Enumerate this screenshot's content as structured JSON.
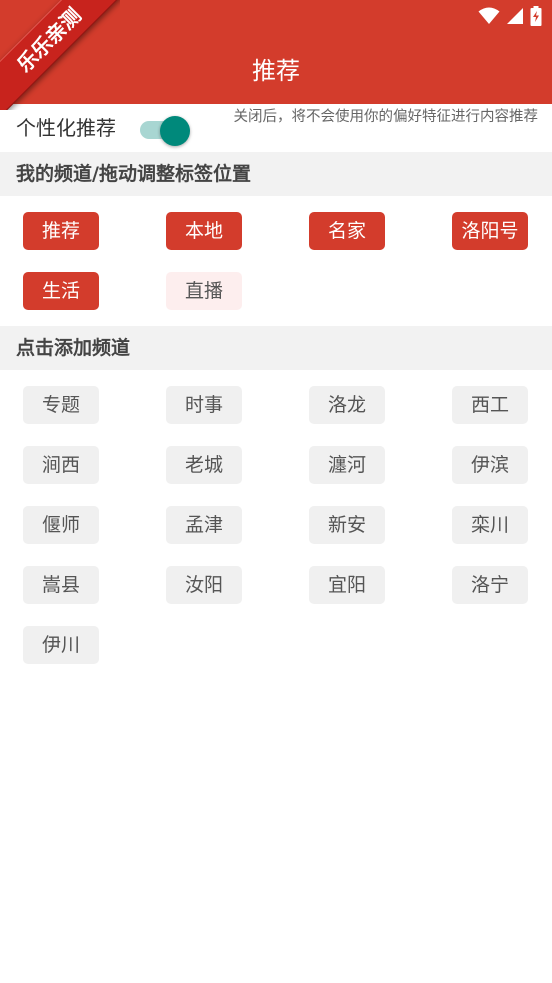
{
  "ribbon": {
    "text": "乐乐亲测"
  },
  "header": {
    "title": "推荐"
  },
  "personalization": {
    "label": "个性化推荐",
    "enabled": true,
    "description": "关闭后，将不会使用你的偏好特征进行内容推荐"
  },
  "my_channels": {
    "title": "我的频道/拖动调整标签位置",
    "items": [
      {
        "label": "推荐",
        "state": "active"
      },
      {
        "label": "本地",
        "state": "active"
      },
      {
        "label": "名家",
        "state": "active"
      },
      {
        "label": "洛阳号",
        "state": "active"
      },
      {
        "label": "生活",
        "state": "active"
      },
      {
        "label": "直播",
        "state": "inactive"
      }
    ]
  },
  "add_channels": {
    "title": "点击添加频道",
    "items": [
      "专题",
      "时事",
      "洛龙",
      "西工",
      "涧西",
      "老城",
      "瀍河",
      "伊滨",
      "偃师",
      "孟津",
      "新安",
      "栾川",
      "嵩县",
      "汝阳",
      "宜阳",
      "洛宁",
      "伊川"
    ]
  },
  "colors": {
    "accent": "#d33c2c",
    "toggle": "#00897b"
  }
}
